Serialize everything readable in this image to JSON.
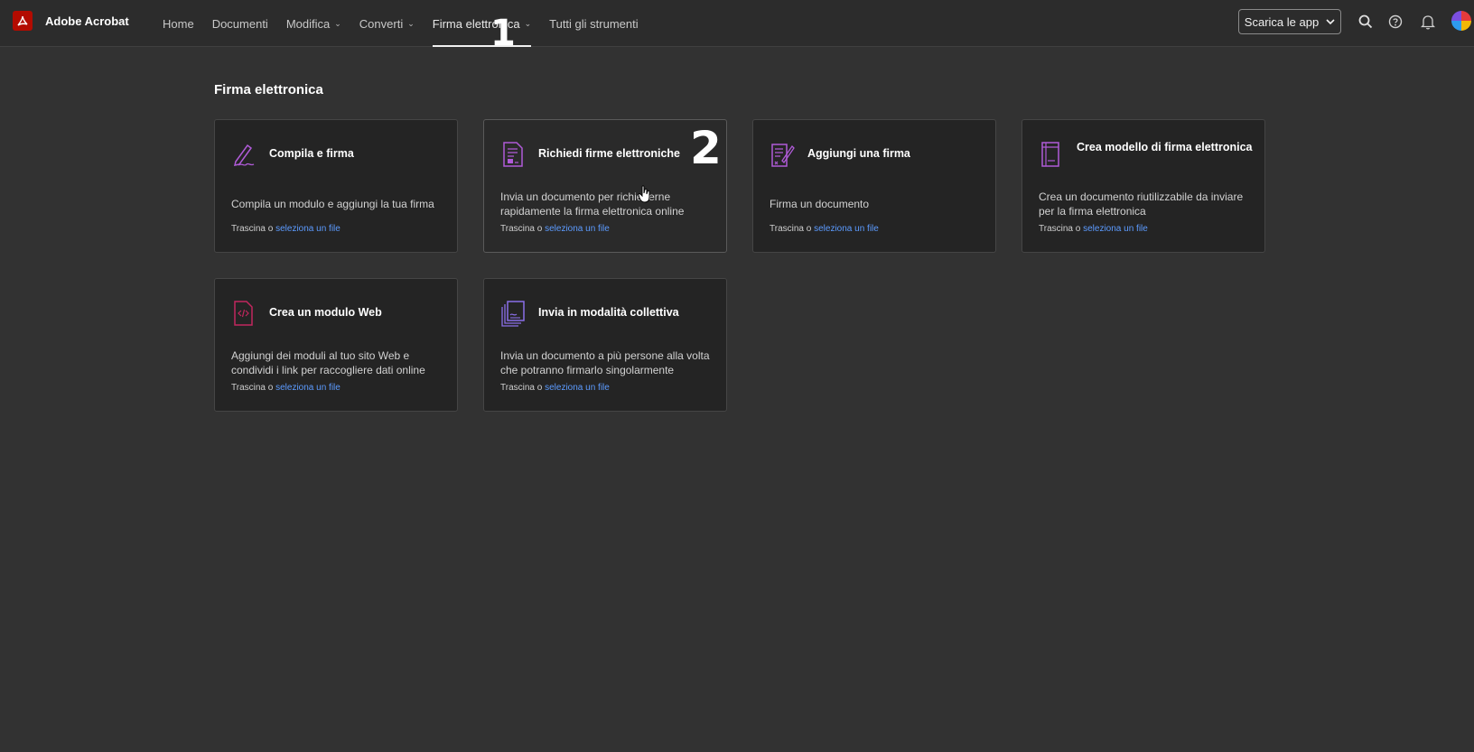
{
  "app": {
    "name": "Adobe Acrobat"
  },
  "nav": [
    {
      "label": "Home",
      "dropdown": false
    },
    {
      "label": "Documenti",
      "dropdown": false
    },
    {
      "label": "Modifica",
      "dropdown": true
    },
    {
      "label": "Converti",
      "dropdown": true
    },
    {
      "label": "Firma elettronica",
      "dropdown": true,
      "active": true
    },
    {
      "label": "Tutti gli strumenti",
      "dropdown": false
    }
  ],
  "header": {
    "download_label": "Scarica le app",
    "icons": [
      "search-icon",
      "help-icon",
      "bell-icon",
      "avatar"
    ]
  },
  "section": {
    "title": "Firma elettronica"
  },
  "cards": [
    {
      "title": "Compila e firma",
      "description": "Compila un modulo e aggiungi la tua firma",
      "drop_text": "Trascina o",
      "link": "seleziona un file",
      "icon": "fill-sign-icon"
    },
    {
      "title": "Richiedi firme elettroniche",
      "description": "Invia un documento per richiederne rapidamente la firma elettronica online",
      "drop_text": "Trascina o",
      "link": "seleziona un file",
      "icon": "request-signatures-icon"
    },
    {
      "title": "Aggiungi una firma",
      "description": "Firma un documento",
      "drop_text": "Trascina o",
      "link": "seleziona un file",
      "icon": "add-signature-icon"
    },
    {
      "title": "Crea modello di firma elettronica",
      "description": "Crea un documento riutilizzabile da inviare per la firma elettronica",
      "drop_text": "Trascina o",
      "link": "seleziona un file",
      "icon": "template-icon"
    },
    {
      "title": "Crea un modulo Web",
      "description": "Aggiungi dei moduli al tuo sito Web e condividi i link per raccogliere dati online",
      "drop_text": "Trascina o",
      "link": "seleziona un file",
      "icon": "web-form-icon"
    },
    {
      "title": "Invia in modalità collettiva",
      "description": "Invia un documento a più persone alla volta che potranno firmarlo singolarmente",
      "drop_text": "Trascina o",
      "link": "seleziona un file",
      "icon": "bulk-send-icon"
    }
  ],
  "annotations": [
    "1",
    "2"
  ],
  "colors": {
    "background": "#323232",
    "card": "#242424",
    "link": "#5c9bff",
    "icon_accent": "#b05bd8",
    "brand": "#b30b00"
  }
}
